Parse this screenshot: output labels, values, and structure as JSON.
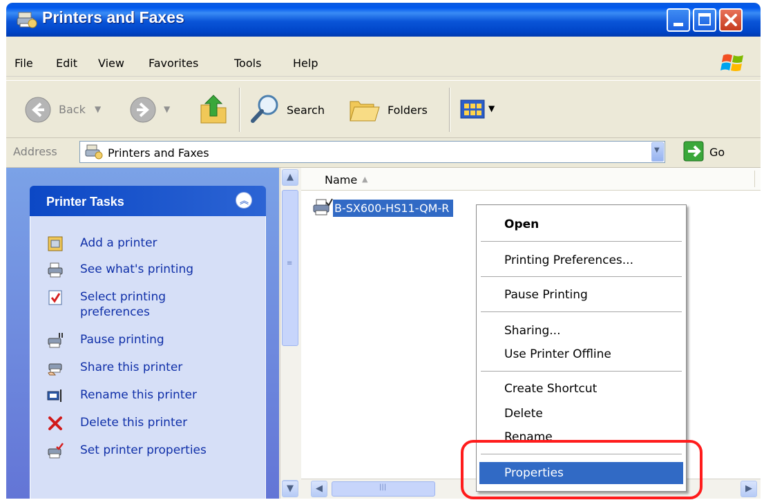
{
  "window": {
    "title": "Printers and Faxes"
  },
  "menu": {
    "items": [
      "File",
      "Edit",
      "View",
      "Favorites",
      "Tools",
      "Help"
    ]
  },
  "toolbar": {
    "back": "Back",
    "search": "Search",
    "folders": "Folders"
  },
  "address": {
    "label": "Address",
    "value": "Printers and Faxes",
    "go": "Go"
  },
  "tasks": {
    "title": "Printer Tasks",
    "items": [
      {
        "label": "Add a printer",
        "icon": "add-printer-icon"
      },
      {
        "label": "See what's printing",
        "icon": "printer-queue-icon"
      },
      {
        "label": "Select printing preferences",
        "icon": "preferences-icon"
      },
      {
        "label": "Pause printing",
        "icon": "pause-printer-icon"
      },
      {
        "label": "Share this printer",
        "icon": "share-printer-icon"
      },
      {
        "label": "Rename this printer",
        "icon": "rename-icon"
      },
      {
        "label": "Delete this printer",
        "icon": "delete-icon"
      },
      {
        "label": "Set printer properties",
        "icon": "properties-icon"
      }
    ]
  },
  "list": {
    "column_name": "Name",
    "items": [
      {
        "name": "B-SX600-HS11-QM-R",
        "selected": true
      }
    ]
  },
  "context_menu": {
    "items": [
      {
        "label": "Open",
        "bold": true
      },
      {
        "label": "Printing Preferences..."
      },
      {
        "label": "Pause Printing"
      },
      {
        "label": "Sharing..."
      },
      {
        "label": "Use Printer Offline"
      },
      {
        "label": "Create Shortcut"
      },
      {
        "label": "Delete"
      },
      {
        "label": "Rename"
      },
      {
        "label": "Properties",
        "selected": true
      }
    ]
  },
  "colors": {
    "selection": "#316ac5",
    "highlight": "#ff1c1c",
    "link": "#0f2fa8"
  }
}
